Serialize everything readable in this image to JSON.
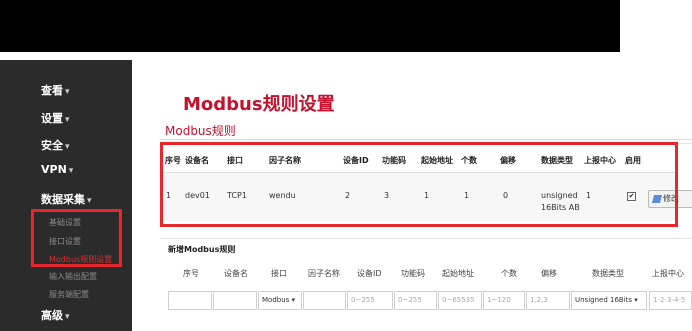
{
  "nav": {
    "items": [
      {
        "label": "查看",
        "caret": "▾"
      },
      {
        "label": "设置",
        "caret": "▾"
      },
      {
        "label": "安全",
        "caret": "▾"
      },
      {
        "label": "VPN",
        "caret": "▾"
      },
      {
        "label": "数据采集",
        "caret": "▾"
      },
      {
        "label": "高级",
        "caret": "▾"
      }
    ],
    "submenu": [
      "基础设置",
      "接口设置",
      "Modbus规则设置",
      "输入输出配置",
      "服务端配置"
    ]
  },
  "page": {
    "title": "Modbus规则设置",
    "section": "Modbus规则"
  },
  "rules_table": {
    "headers": [
      "序号",
      "设备名",
      "接口",
      "因子名称",
      "设备ID",
      "功能码",
      "起始地址",
      "个数",
      "偏移",
      "数据类型",
      "上报中心",
      "启用"
    ],
    "row": {
      "index": "1",
      "device": "dev01",
      "interface": "TCP1",
      "factor": "wendu",
      "device_id": "2",
      "func_code": "3",
      "start_addr": "1",
      "count": "1",
      "offset": "0",
      "dtype_line1": "unsigned",
      "dtype_line2": "16Bits AB",
      "center": "1",
      "enabled": "✔"
    },
    "edit_label": "修改"
  },
  "add_form": {
    "title": "新增Modbus规则",
    "headers": [
      "序号",
      "设备名",
      "接口",
      "因子名称",
      "设备ID",
      "功能码",
      "起始地址",
      "个数",
      "偏移",
      "数据类型",
      "上报中心"
    ],
    "interface_value": "Modbus ▾",
    "placeholders": {
      "device_id": "0~255",
      "func_code": "0~255",
      "start_addr": "0~65535",
      "count": "1~120",
      "offset": "1,2,3",
      "center": "1-2-3-4-5"
    },
    "dtype_value": "Unsigned 16Bits ▾"
  }
}
